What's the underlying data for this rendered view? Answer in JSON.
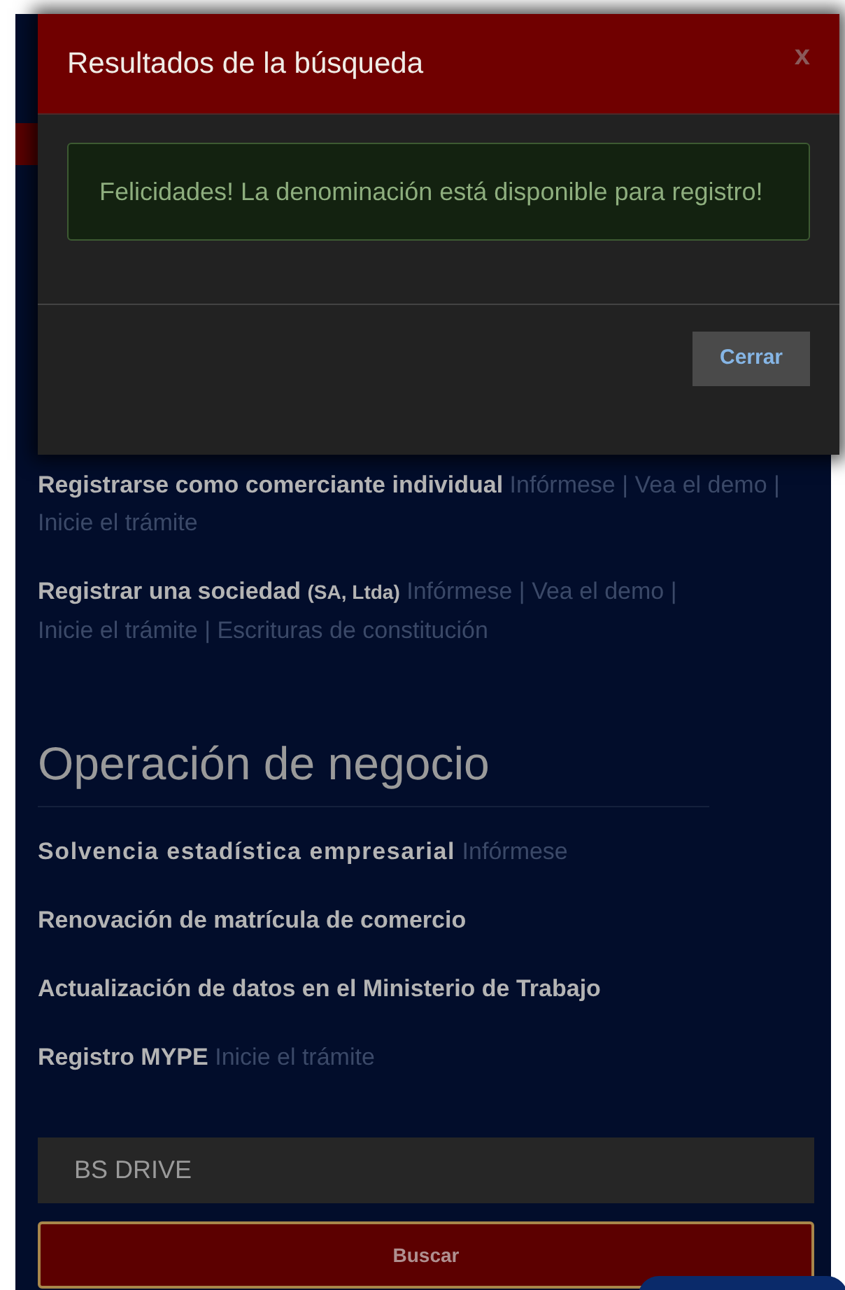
{
  "modal": {
    "title": "Resultados de la búsqueda",
    "close_label": "x",
    "alert": "Felicidades! La denominación está disponible para registro!",
    "button": "Cerrar"
  },
  "sections": [
    {
      "items": [
        {
          "title": "Registrarse como comerciante individual",
          "links": [
            "Infórmese",
            "Vea el demo",
            "Inicie el trámite"
          ]
        },
        {
          "title": "Registrar una sociedad",
          "note": "(SA, Ltda)",
          "links": [
            "Infórmese",
            "Vea el demo",
            "Inicie el trámite",
            "Escrituras de constitución"
          ]
        }
      ]
    },
    {
      "heading": "Operación de negocio",
      "items": [
        {
          "title": "Solvencia estadística empresarial",
          "links": [
            "Infórmese"
          ]
        },
        {
          "title": "Renovación de matrícula de comercio"
        },
        {
          "title": "Actualización de datos en el Ministerio de Trabajo"
        },
        {
          "title": "Registro MYPE",
          "links": [
            "Inicie el trámite"
          ]
        }
      ]
    }
  ],
  "separator": "|",
  "search": {
    "value": "BS DRIVE",
    "button": "Buscar"
  }
}
